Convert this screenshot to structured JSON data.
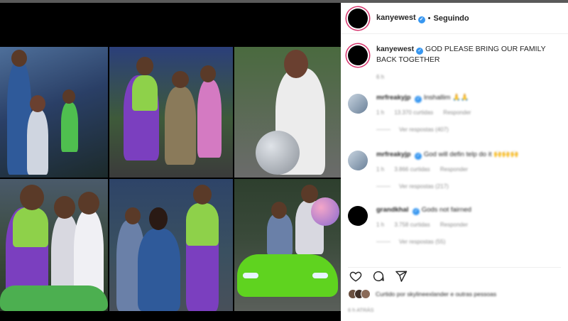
{
  "post": {
    "username": "kanyewest",
    "follow_status": "Seguindo",
    "separator": "•",
    "caption": "GOD PLEASE BRING OUR FAMILY BACK TOGETHER",
    "caption_time": "6 h"
  },
  "photos": [
    {
      "label": "photo-1"
    },
    {
      "label": "photo-2"
    },
    {
      "label": "photo-3"
    },
    {
      "label": "photo-4"
    },
    {
      "label": "photo-5"
    },
    {
      "label": "photo-6"
    }
  ],
  "comments": [
    {
      "username": "mrfreakyjp",
      "text": "Inshallim 🙏🙏",
      "time": "1 h",
      "likes": "13.370 curtidas",
      "reply": "Responder",
      "replies": "Ver respostas (407)",
      "avatar_color": "#8aa0b8"
    },
    {
      "username": "mrfreakyjp",
      "text": "God will defin telp do it 🙌🙌🙌",
      "time": "1 h",
      "likes": "3.866 curtidas",
      "reply": "Responder",
      "replies": "Ver respostas (217)",
      "avatar_color": "#8aa0b8"
    },
    {
      "username": "grandkhal",
      "text": "Gods not fairned",
      "time": "1 h",
      "likes": "3.758 curtidas",
      "reply": "Responder",
      "replies": "Ver respostas (55)",
      "avatar_color": "#000000"
    }
  ],
  "likes_line": {
    "text": "Curtido por skylineexlander e outras pessoas"
  },
  "date": "6 h ATRÁS",
  "colors": {
    "verified": "#3897f0",
    "story_ring": "#d6336c",
    "muted": "#8e8e8e"
  }
}
